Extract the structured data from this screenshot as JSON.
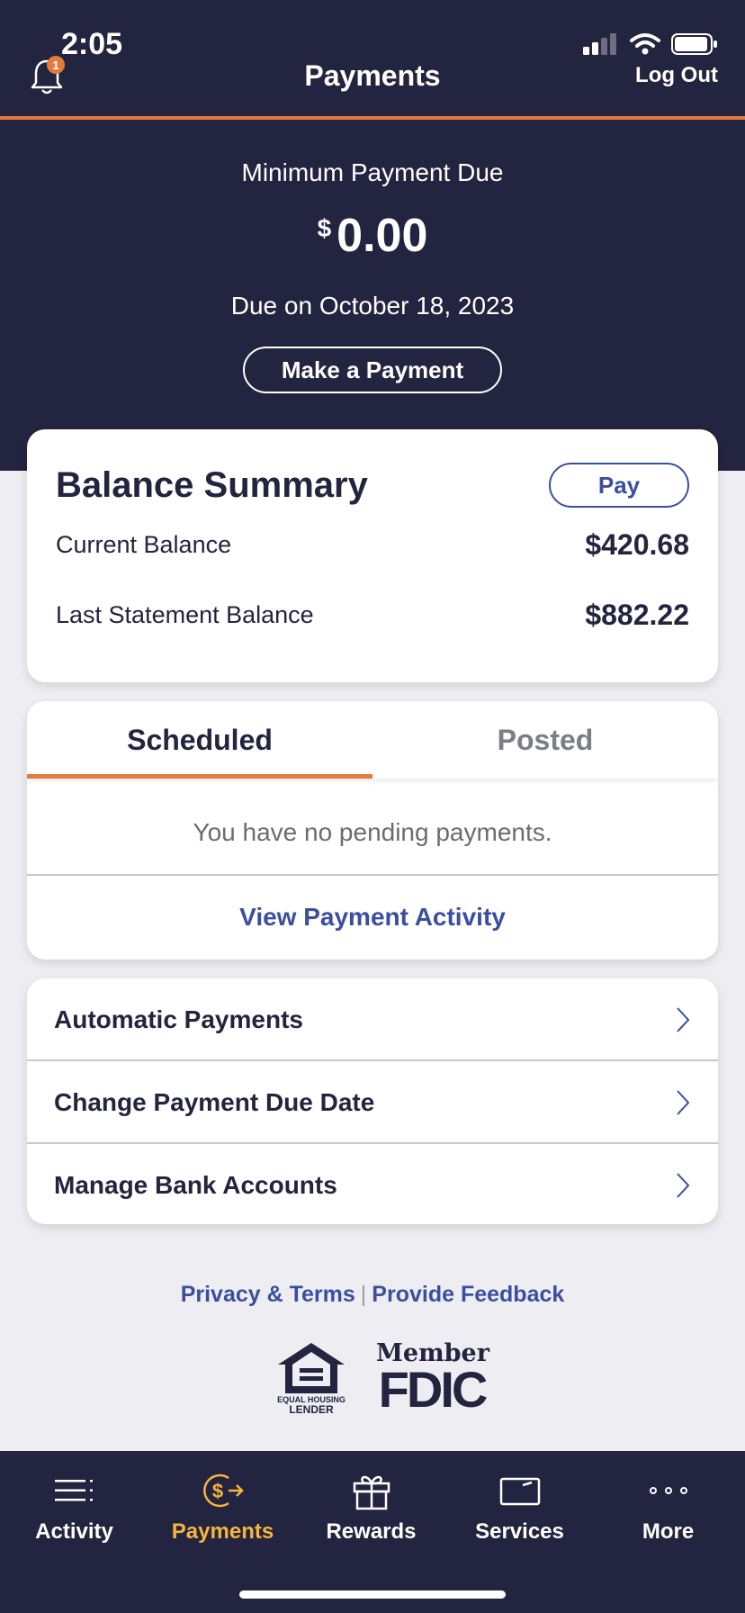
{
  "status_bar": {
    "time": "2:05"
  },
  "header": {
    "title": "Payments",
    "logout_label": "Log Out",
    "notification_count": "1"
  },
  "summary": {
    "min_label": "Minimum Payment Due",
    "currency": "$",
    "amount": "0.00",
    "due_date": "Due on October 18, 2023",
    "make_payment_label": "Make a Payment"
  },
  "balance": {
    "title": "Balance Summary",
    "pay_label": "Pay",
    "rows": [
      {
        "label": "Current Balance",
        "amount": "$420.68"
      },
      {
        "label": "Last Statement Balance",
        "amount": "$882.22"
      }
    ]
  },
  "payments": {
    "tabs": [
      {
        "label": "Scheduled",
        "active": true
      },
      {
        "label": "Posted",
        "active": false
      }
    ],
    "empty_message": "You have no pending payments.",
    "view_activity_label": "View Payment Activity"
  },
  "links": [
    {
      "label": "Automatic Payments"
    },
    {
      "label": "Change Payment Due Date"
    },
    {
      "label": "Manage Bank Accounts"
    }
  ],
  "footer": {
    "privacy_label": "Privacy & Terms",
    "separator": "|",
    "feedback_label": "Provide Feedback",
    "ehl_logo_text": "EQUAL HOUSING LENDER",
    "fdic_member": "Member",
    "fdic_word": "FDIC"
  },
  "bottom_nav": [
    {
      "label": "Activity",
      "icon": "list-icon",
      "active": false
    },
    {
      "label": "Payments",
      "icon": "dollar-arrow-icon",
      "active": true
    },
    {
      "label": "Rewards",
      "icon": "gift-icon",
      "active": false
    },
    {
      "label": "Services",
      "icon": "card-icon",
      "active": false
    },
    {
      "label": "More",
      "icon": "more-dots-icon",
      "active": false
    }
  ],
  "colors": {
    "navy": "#23243f",
    "accent_orange": "#e47b3d",
    "link_blue": "#3a4f9e",
    "active_nav": "#f5b53d"
  }
}
